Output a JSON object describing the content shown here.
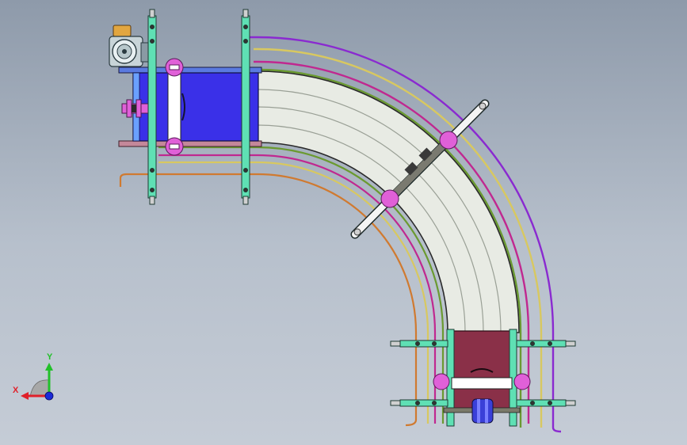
{
  "triad": {
    "x_label": "X",
    "y_label": "Y",
    "x_color": "#e0202a",
    "y_color": "#22c02a",
    "z_color": "#1a2ad8"
  },
  "colors": {
    "background_top": "#8e9aaa",
    "background_bottom": "#c5ccd6",
    "belt": "#e8ebe4",
    "belt_edge": "#2a2a2a",
    "belt_line": "#9aa096",
    "end_frame_blue": "#3a30e8",
    "end_frame_maroon": "#8a3048",
    "roller_white": "#ffffff",
    "bearing_magenta": "#e060d8",
    "bracket_cyan": "#5fe0b4",
    "rail_purple": "#8a2ad0",
    "rail_yellow": "#d8c860",
    "rail_magenta": "#c02890",
    "rail_green": "#6a9a30",
    "rail_orange": "#d07a30",
    "motor_body": "#c8d4d8",
    "motor_cap": "#e2a640"
  }
}
